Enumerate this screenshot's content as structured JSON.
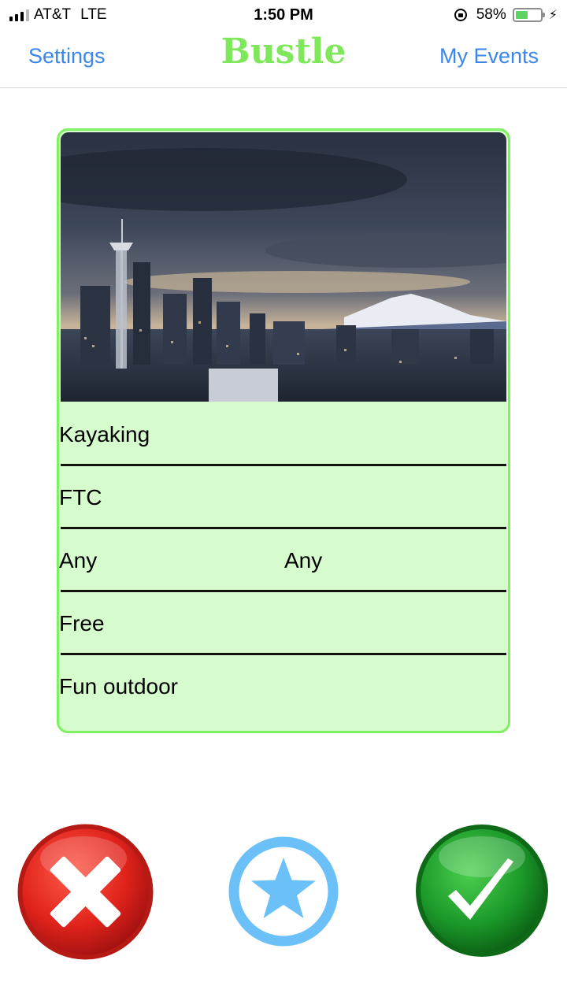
{
  "status_bar": {
    "carrier": "AT&T",
    "network": "LTE",
    "time": "1:50 PM",
    "battery_percent": "58%",
    "battery_level": 0.58,
    "icons": [
      "signal-bars-icon",
      "rotation-lock-icon",
      "battery-icon",
      "charging-bolt-icon"
    ]
  },
  "nav": {
    "left_label": "Settings",
    "title": "Bustle",
    "right_label": "My Events"
  },
  "colors": {
    "accent_blue": "#3b86ea",
    "brand_green": "#7ee85a",
    "card_bg": "#d6fbcc",
    "card_border": "#7ef062",
    "reject_red": "#d9231d",
    "favorite_blue": "#6cc0f8",
    "accept_green": "#1c9a2a"
  },
  "event": {
    "image": "city-skyline-photo",
    "name": "Kayaking",
    "location": "FTC",
    "time_from": "Any",
    "time_to": "Any",
    "price": "Free",
    "description": "Fun outdoor"
  },
  "actions": {
    "reject_icon": "close-x-icon",
    "favorite_icon": "star-icon",
    "accept_icon": "checkmark-icon"
  }
}
